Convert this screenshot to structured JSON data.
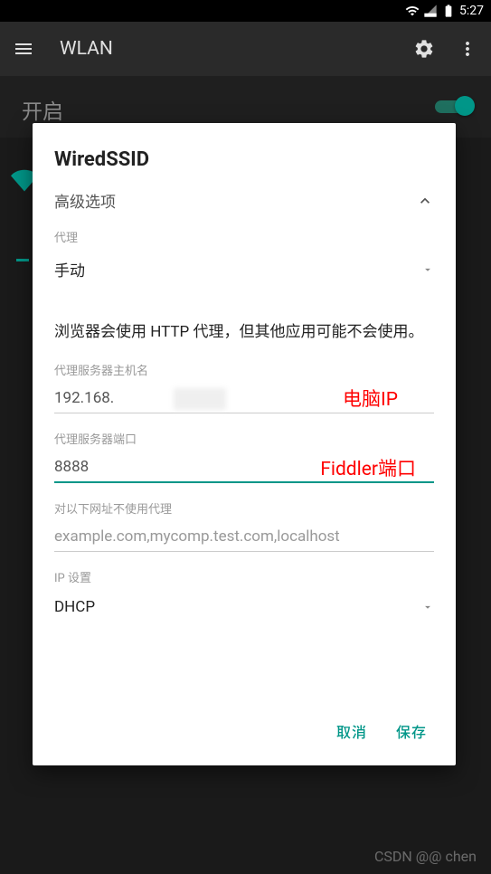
{
  "status": {
    "time": "5:27"
  },
  "appBar": {
    "title": "WLAN"
  },
  "subHeader": {
    "title": "开启"
  },
  "dialog": {
    "title": "WiredSSID",
    "advanced": "高级选项",
    "proxy_label": "代理",
    "proxy_value": "手动",
    "info": "浏览器会使用 HTTP 代理，但其他应用可能不会使用。",
    "host_label": "代理服务器主机名",
    "host_value": "192.168.",
    "host_annotation": "电脑IP",
    "port_label": "代理服务器端口",
    "port_value": "8888",
    "port_annotation": "Fiddler端口",
    "bypass_label": "对以下网址不使用代理",
    "bypass_placeholder": "example.com,mycomp.test.com,localhost",
    "ip_label": "IP 设置",
    "ip_value": "DHCP",
    "cancel": "取消",
    "save": "保存"
  },
  "watermark": "CSDN @@ chen"
}
